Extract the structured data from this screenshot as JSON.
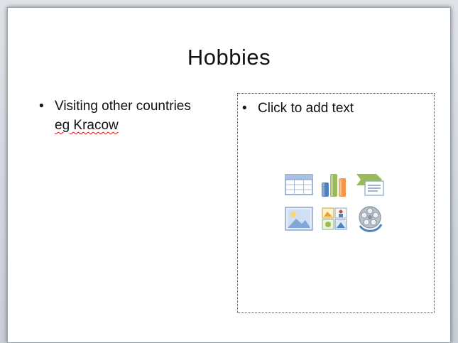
{
  "slide": {
    "title": "Hobbies",
    "left_placeholder": {
      "bullet": "•",
      "text_line1": "Visiting other countries",
      "text_line2": "eg Kracow"
    },
    "right_placeholder": {
      "bullet": "•",
      "prompt": "Click to add text",
      "insert_icons": [
        "insert-table-icon",
        "insert-chart-icon",
        "insert-smartart-icon",
        "insert-picture-icon",
        "insert-clip-art-icon",
        "insert-media-clip-icon"
      ]
    }
  },
  "colors": {
    "background": "#ffffff",
    "spellcheck_underline": "#dd1111",
    "chart_blue": "#4f81bd",
    "chart_orange": "#f79646",
    "smartart_green": "#9bbb59"
  }
}
